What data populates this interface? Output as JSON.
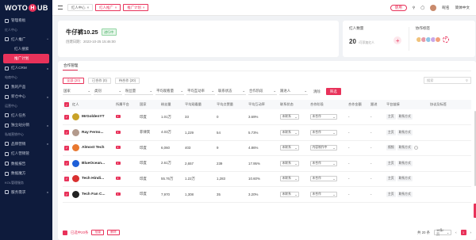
{
  "brand": {
    "logo_left": "WOTO",
    "logo_badge": "H",
    "logo_right": "UB",
    "accent": "#e8325a",
    "sidebar_bg": "#0e1b3c"
  },
  "sidebar": {
    "items": [
      {
        "label": "管理看板",
        "icon": "home-icon"
      },
      {
        "section": "红人中心"
      },
      {
        "label": "红人推广",
        "icon": "user-icon",
        "caret": "^"
      },
      {
        "sub": "红人搜索"
      },
      {
        "sub": "推广计划",
        "active": true
      },
      {
        "label": "红人CRM",
        "icon": "crm-icon",
        "caret": "v"
      },
      {
        "section": "电商中心"
      },
      {
        "label": "我的产品",
        "icon": "box-icon"
      },
      {
        "label": "新仓中心",
        "icon": "store-icon",
        "caret": "v"
      },
      {
        "section": "运营中心"
      },
      {
        "label": "红人任务",
        "icon": "task-icon"
      },
      {
        "label": "独立站分销",
        "icon": "share-icon",
        "caret": "v"
      },
      {
        "section": "私域营销中心"
      },
      {
        "label": "品牌营销",
        "icon": "brand-icon",
        "caret": "v"
      },
      {
        "label": "红人营销管",
        "icon": "megaphone-icon"
      },
      {
        "label": "数据报告",
        "icon": "chart-icon"
      },
      {
        "label": "数据魔方",
        "icon": "cube-icon"
      },
      {
        "section": "KOL管理服务"
      },
      {
        "label": "服务需求",
        "icon": "service-icon",
        "caret": "v"
      }
    ]
  },
  "topbar": {
    "tabs": [
      {
        "label": "红人中心",
        "active": false
      },
      {
        "label": "红人推广",
        "active": true
      },
      {
        "label": "推广计划",
        "active": true
      }
    ],
    "help": "使用",
    "user": "昵名",
    "lang": "简体中文"
  },
  "header": {
    "title": "牛仔裤10.25",
    "status": "进行中",
    "created": "创建日期：2023-10-25 15:46:00"
  },
  "kpis": {
    "influencer_label": "红人数量",
    "influencer_value": "20",
    "influencer_sub": "/可添加红人",
    "tags_label": "协作标签",
    "tag_colors": [
      "#f0c27b",
      "#e79aa8",
      "#8ec5e6",
      "#c8a7e8",
      "#f2a07b"
    ]
  },
  "main": {
    "subtab": "合作管理",
    "pills": [
      {
        "label": "全部 (20)",
        "active": true
      },
      {
        "label": "已合作 (0)",
        "active": false
      },
      {
        "label": "待合作 (20)",
        "active": false
      }
    ],
    "search_placeholder": "搜索",
    "filters": [
      "国家",
      "类别",
      "粉丝量",
      "平均观看量",
      "平均互动率",
      "联系状态",
      "合作阶段",
      "跟进人"
    ],
    "reset": "清除",
    "search_btn": "筛选"
  },
  "table": {
    "columns": [
      "红人",
      "所属平台",
      "国家",
      "粉丝量",
      "平均观看量",
      "平均点赞量",
      "平均互动率",
      "联系状态",
      "合作阶段",
      "合作金额",
      "跟进",
      "平台链接",
      "协议及标签"
    ],
    "rows": [
      {
        "name": "MrGoldenYT",
        "avatar": "#c9a227",
        "country": "印度",
        "fans": "1.01万",
        "views": "33",
        "likes": "0",
        "rate": "3.69%",
        "status": "未联系",
        "stage": "未合作",
        "amount": "-",
        "follow": "-",
        "ops": [
          "主页",
          "联系方式"
        ]
      },
      {
        "name": "Ray Ferno...",
        "avatar": "#b39a8c",
        "country": "菲律宾",
        "fans": "4.03万",
        "views": "1,229",
        "likes": "54",
        "rate": "5.73%",
        "status": "未联系",
        "stage": "未合作",
        "amount": "-",
        "follow": "-",
        "ops": [
          "主页",
          "联系方式"
        ]
      },
      {
        "name": "Almost Tech",
        "avatar": "#e87830",
        "country": "印度",
        "fans": "6,060",
        "views": "403",
        "likes": "9",
        "rate": "4.86%",
        "status": "未联系",
        "stage": "内容制作中",
        "amount": "-",
        "follow": "-",
        "ops": [
          "视频",
          "联系方式"
        ]
      },
      {
        "name": "BlueOcean...",
        "avatar": "#1e5fd8",
        "country": "印度",
        "fans": "2.61万",
        "views": "2,657",
        "likes": "239",
        "rate": "17.95%",
        "status": "未联系",
        "stage": "未合作",
        "amount": "-",
        "follow": "-",
        "ops": [
          "主页",
          "联系方式"
        ]
      },
      {
        "name": "Tech Hindi...",
        "avatar": "#d93030",
        "country": "印度",
        "fans": "55.76万",
        "views": "1.22万",
        "likes": "1,283",
        "rate": "10.60%",
        "status": "未联系",
        "stage": "未合作",
        "amount": "-",
        "follow": "-",
        "ops": [
          "主页",
          "联系方式"
        ]
      },
      {
        "name": "Tech Fan C...",
        "avatar": "#222222",
        "country": "印度",
        "fans": "7,970",
        "views": "1,308",
        "likes": "35",
        "rate": "3.20%",
        "status": "未联系",
        "stage": "未合作",
        "amount": "-",
        "follow": "-",
        "ops": [
          "主页",
          "联系方式"
        ]
      }
    ]
  },
  "footer": {
    "selected": "已选中20条",
    "batch1": "批量",
    "batch2": "删除",
    "total": "共 20 条",
    "page_size": "10条/页",
    "page": "1"
  }
}
